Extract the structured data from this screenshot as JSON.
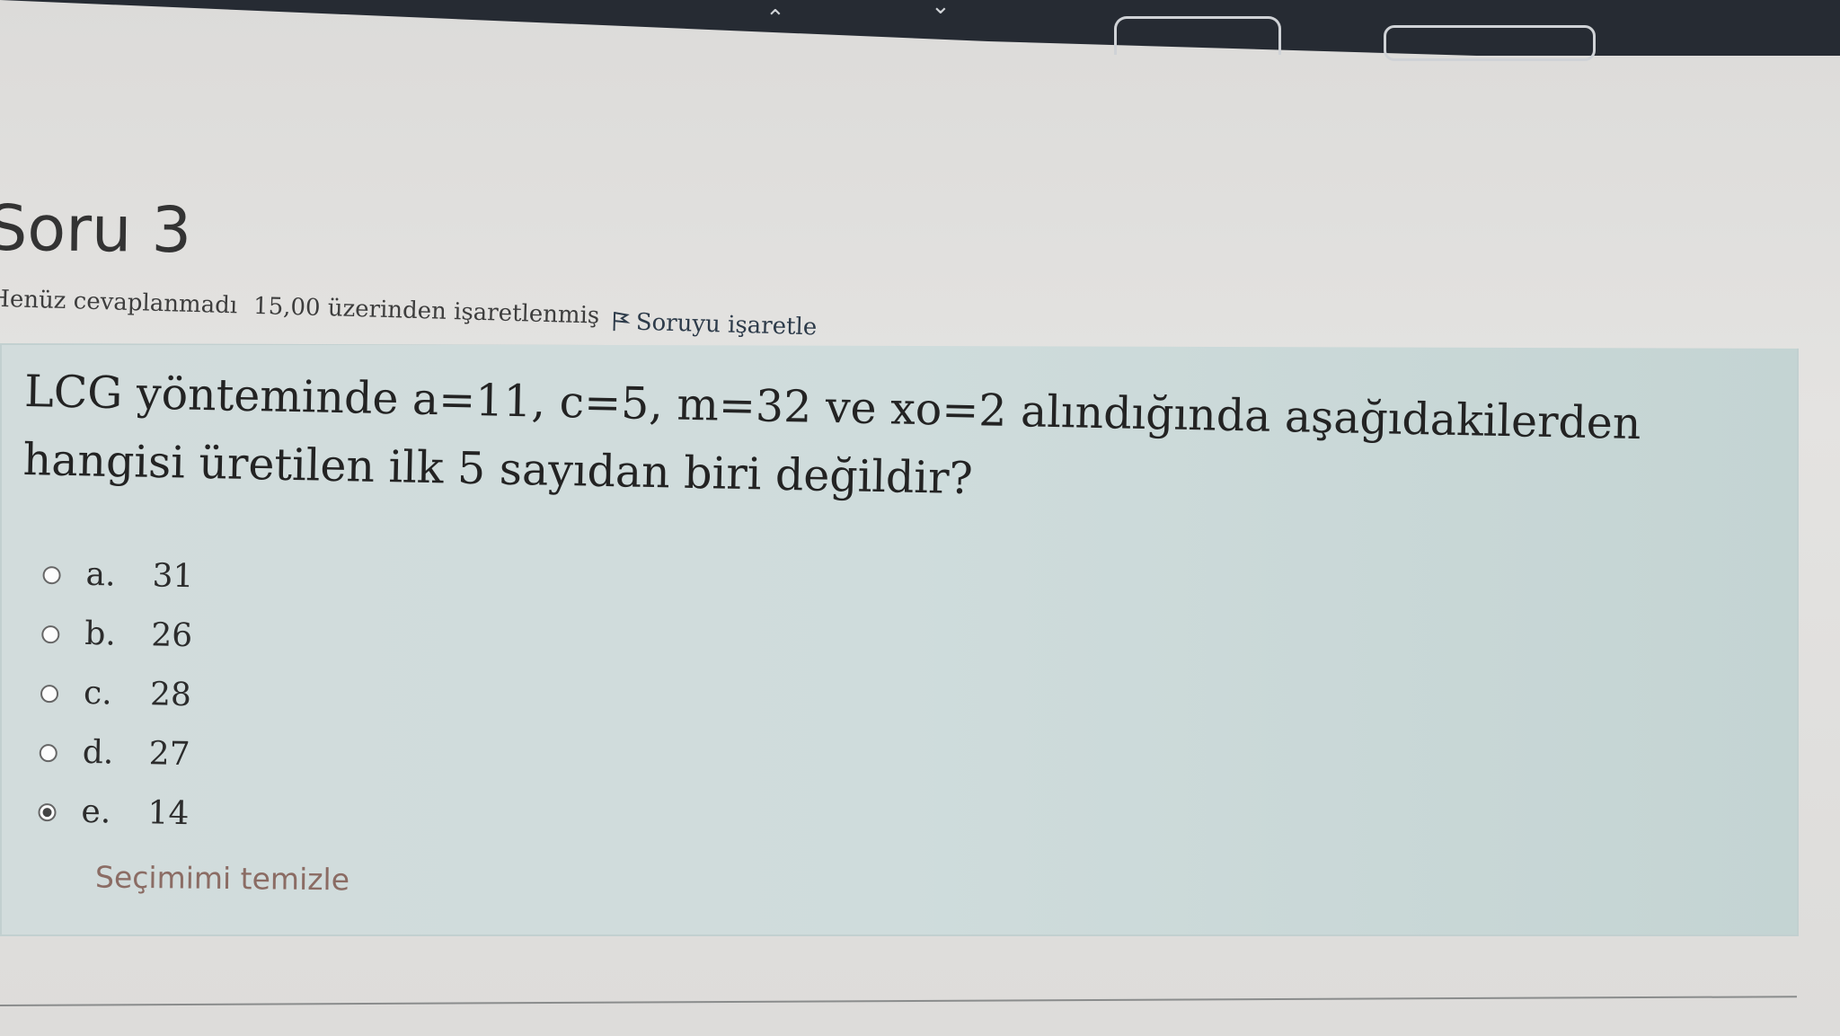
{
  "question": {
    "title": "Soru 3",
    "status": "Henüz cevaplanmadı",
    "grade": "15,00 üzerinden işaretlenmiş",
    "flag_label": "Soruyu işaretle",
    "text": "LCG yönteminde a=11, c=5, m=32 ve xo=2 alındığında aşağıdakilerden hangisi üretilen ilk 5 sayıdan biri değildir?",
    "options": [
      {
        "letter": "a.",
        "value": "31",
        "selected": false
      },
      {
        "letter": "b.",
        "value": "26",
        "selected": false
      },
      {
        "letter": "c.",
        "value": "28",
        "selected": false
      },
      {
        "letter": "d.",
        "value": "27",
        "selected": false
      },
      {
        "letter": "e.",
        "value": "14",
        "selected": true
      }
    ],
    "clear_label": "Seçimimi temizle"
  },
  "icons": {
    "flag": "flag-icon",
    "radio_unchecked": "radio-unchecked-icon",
    "radio_checked": "radio-checked-icon"
  },
  "colors": {
    "question_bg": "#cfdcdc",
    "clear_link": "#8b6c64",
    "topbar": "#262b33"
  }
}
